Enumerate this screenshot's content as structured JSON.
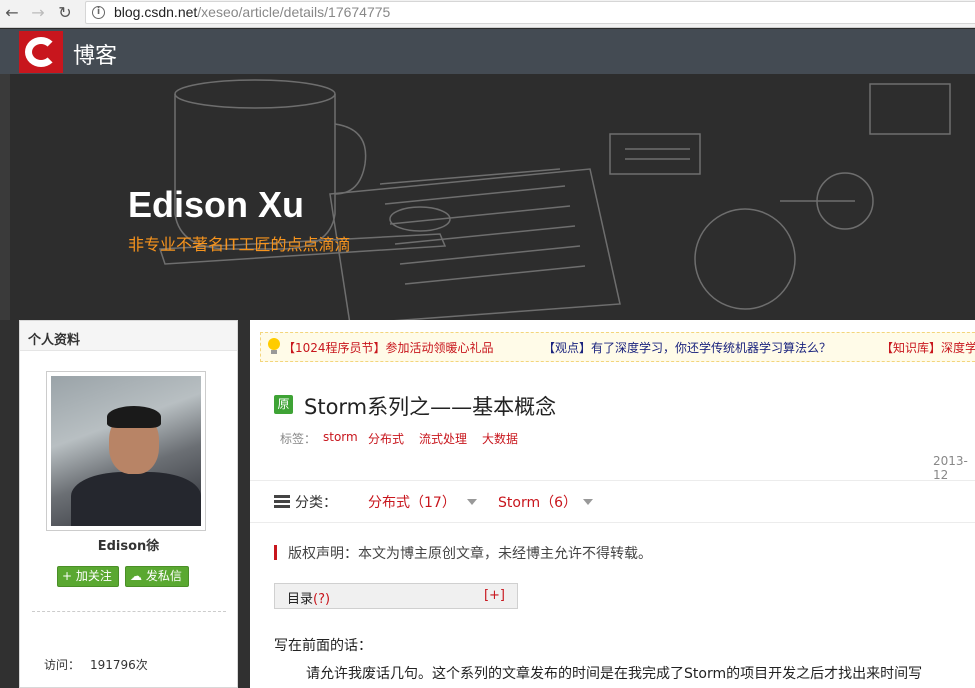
{
  "browser": {
    "url_domain": "blog.csdn.net",
    "url_path": "/xeseo/article/details/17674775"
  },
  "topbar": {
    "title": "博客"
  },
  "banner": {
    "blog_title": "Edison Xu",
    "subtitle": "非专业不著名IT工匠的点点滴滴"
  },
  "sidebar": {
    "header": "个人资料",
    "username": "Edison徐",
    "follow_label": "加关注",
    "message_label": "发私信",
    "visits_label": "访问：",
    "visits_value": "191796次"
  },
  "notice": {
    "items": [
      "【1024程序员节】参加活动领暖心礼品",
      "【观点】有了深度学习，你还学传统机器学习算法么？",
      "【知识库】深度学"
    ]
  },
  "article": {
    "badge": "原",
    "title": "Storm系列之——基本概念",
    "tags_label": "标签：",
    "tags": [
      "storm",
      "分布式",
      "流式处理",
      "大数据"
    ],
    "date": "2013-12",
    "category_label": "分类：",
    "categories": [
      "分布式（17）",
      "Storm（6）"
    ],
    "copyright": "版权声明：本文为博主原创文章，未经博主允许不得转载。",
    "toc_label": "目录",
    "toc_q": "(?)",
    "toc_expand": "[+]",
    "para_head": "写在前面的话：",
    "para_body": "请允许我废话几句。这个系列的文章发布的时间是在我完成了Storm的项目开发之后才找出来时间写"
  },
  "colors": {
    "brand_red": "#c8161d",
    "accent_orange": "#f7941d",
    "green": "#5aa831",
    "topbar": "#444b53"
  }
}
